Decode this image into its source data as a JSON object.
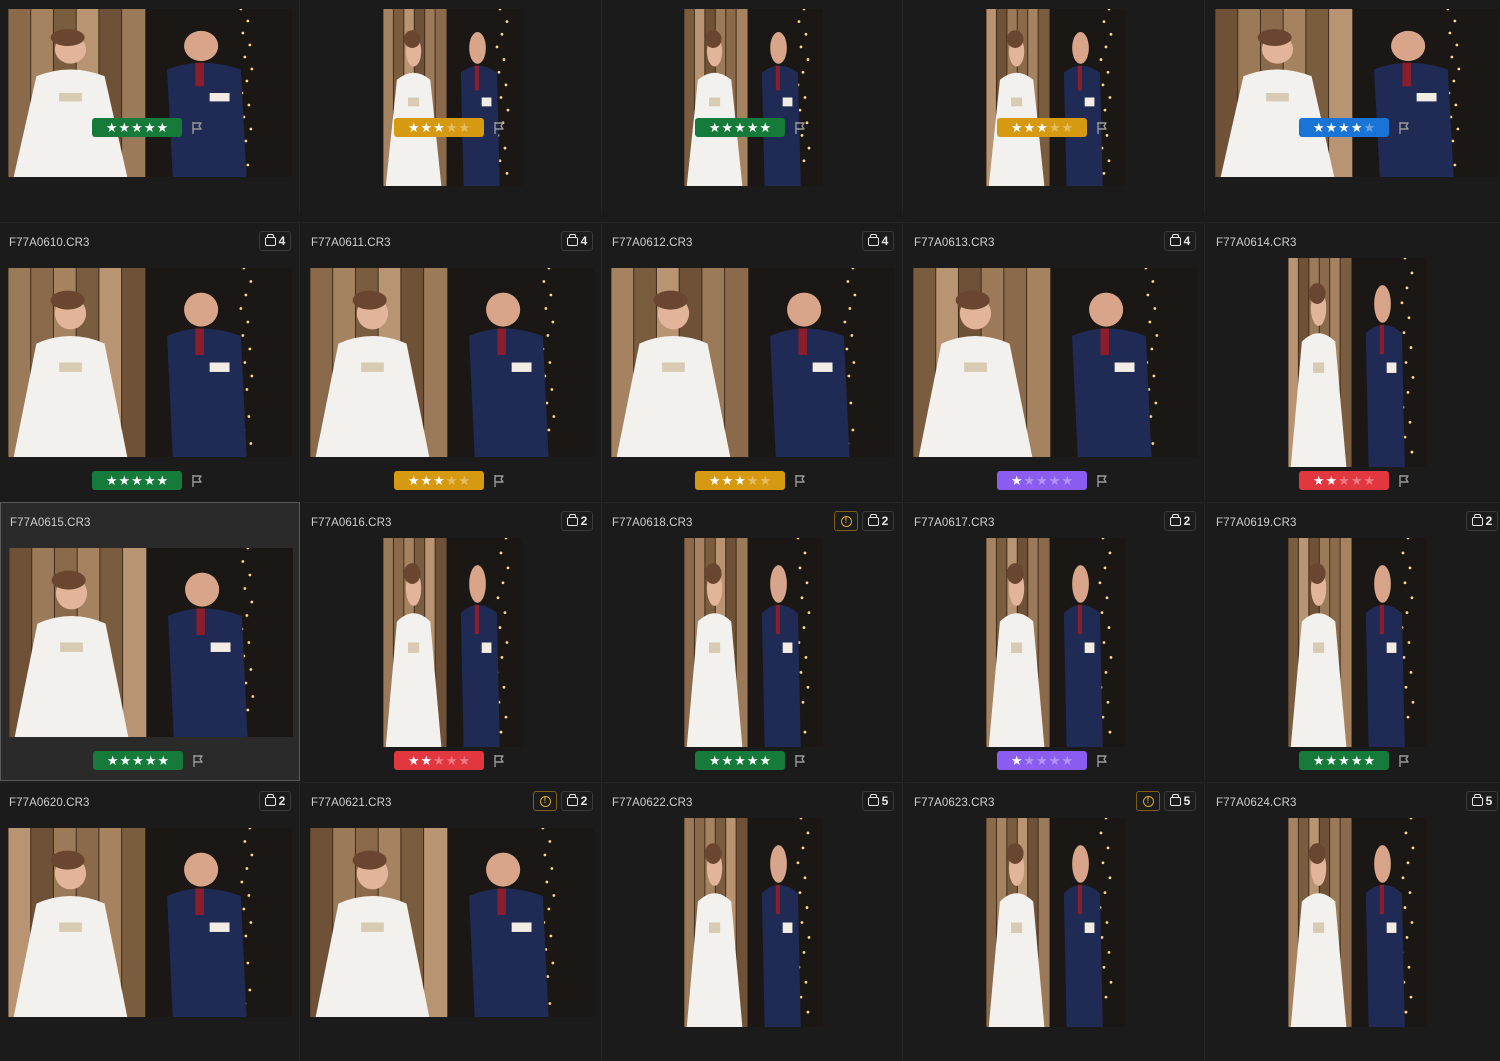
{
  "colors": {
    "green": "#157a3a",
    "orange": "#d69a12",
    "blue": "#1a74d6",
    "purple": "#8a5cf0",
    "red": "#e2373f"
  },
  "rows": [
    [
      {
        "file": "",
        "stack": "",
        "warning": false,
        "stars": 5,
        "color": "green",
        "orientation": "landscape"
      },
      {
        "file": "",
        "stack": "",
        "warning": false,
        "stars": 3,
        "color": "orange",
        "orientation": "portrait"
      },
      {
        "file": "",
        "stack": "",
        "warning": false,
        "stars": 5,
        "color": "green",
        "orientation": "portrait"
      },
      {
        "file": "",
        "stack": "",
        "warning": false,
        "stars": 3,
        "color": "orange",
        "orientation": "portrait"
      },
      {
        "file": "",
        "stack": "",
        "warning": false,
        "stars": 4,
        "color": "blue",
        "orientation": "landscape"
      }
    ],
    [
      {
        "file": "F77A0610.CR3",
        "stack": "4",
        "warning": false,
        "stars": 5,
        "color": "green",
        "orientation": "landscape"
      },
      {
        "file": "F77A0611.CR3",
        "stack": "4",
        "warning": false,
        "stars": 3,
        "color": "orange",
        "orientation": "landscape"
      },
      {
        "file": "F77A0612.CR3",
        "stack": "4",
        "warning": false,
        "stars": 3,
        "color": "orange",
        "orientation": "landscape"
      },
      {
        "file": "F77A0613.CR3",
        "stack": "4",
        "warning": false,
        "stars": 1,
        "color": "purple",
        "orientation": "landscape"
      },
      {
        "file": "F77A0614.CR3",
        "stack": "",
        "warning": false,
        "stars": 2,
        "color": "red",
        "orientation": "portrait"
      }
    ],
    [
      {
        "file": "F77A0615.CR3",
        "stack": "",
        "warning": false,
        "stars": 5,
        "color": "green",
        "orientation": "landscape",
        "selected": true
      },
      {
        "file": "F77A0616.CR3",
        "stack": "2",
        "warning": false,
        "stars": 2,
        "color": "red",
        "orientation": "portrait"
      },
      {
        "file": "F77A0618.CR3",
        "stack": "2",
        "warning": true,
        "stars": 5,
        "color": "green",
        "orientation": "portrait"
      },
      {
        "file": "F77A0617.CR3",
        "stack": "2",
        "warning": false,
        "stars": 1,
        "color": "purple",
        "orientation": "portrait"
      },
      {
        "file": "F77A0619.CR3",
        "stack": "2",
        "warning": false,
        "stars": 5,
        "color": "green",
        "orientation": "portrait"
      }
    ],
    [
      {
        "file": "F77A0620.CR3",
        "stack": "2",
        "warning": false,
        "orientation": "landscape"
      },
      {
        "file": "F77A0621.CR3",
        "stack": "2",
        "warning": true,
        "orientation": "landscape"
      },
      {
        "file": "F77A0622.CR3",
        "stack": "5",
        "warning": false,
        "orientation": "portrait"
      },
      {
        "file": "F77A0623.CR3",
        "stack": "5",
        "warning": true,
        "orientation": "portrait"
      },
      {
        "file": "F77A0624.CR3",
        "stack": "5",
        "warning": false,
        "orientation": "portrait"
      }
    ]
  ]
}
